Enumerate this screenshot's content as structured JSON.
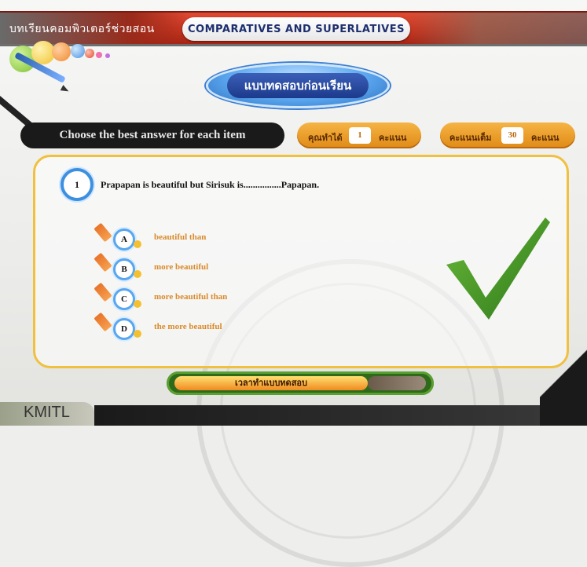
{
  "header": {
    "course_tab": "บทเรียนคอมพิวเตอร์ช่วยสอน",
    "title": "COMPARATIVES AND SUPERLATIVES"
  },
  "section_title": "แบบทดสอบก่อนเรียน",
  "instruction": "Choose the best answer for each item",
  "score": {
    "label": "คุณทำได้",
    "value": "1",
    "unit": "คะแนน"
  },
  "total": {
    "label": "คะแนนเต็ม",
    "value": "30",
    "unit": "คะแนน"
  },
  "question": {
    "number": "1",
    "text": "Prapapan is beautiful but Sirisuk is................Papapan."
  },
  "options": [
    {
      "letter": "A",
      "text": "beautiful than"
    },
    {
      "letter": "B",
      "text": "more beautiful"
    },
    {
      "letter": "C",
      "text": "more  beautiful than"
    },
    {
      "letter": "D",
      "text": "the more beautiful"
    }
  ],
  "feedback_icon": "checkmark-icon",
  "timer": {
    "label": "เวลาทำแบบทดสอบ",
    "progress": 0.77
  },
  "footer": {
    "brand": "KMITL"
  },
  "colors": {
    "banner": "#c73520",
    "accent_blue": "#3d8fe0",
    "panel_border": "#f0c040",
    "check": "#4a9a2a",
    "option_text": "#d98a2a"
  }
}
